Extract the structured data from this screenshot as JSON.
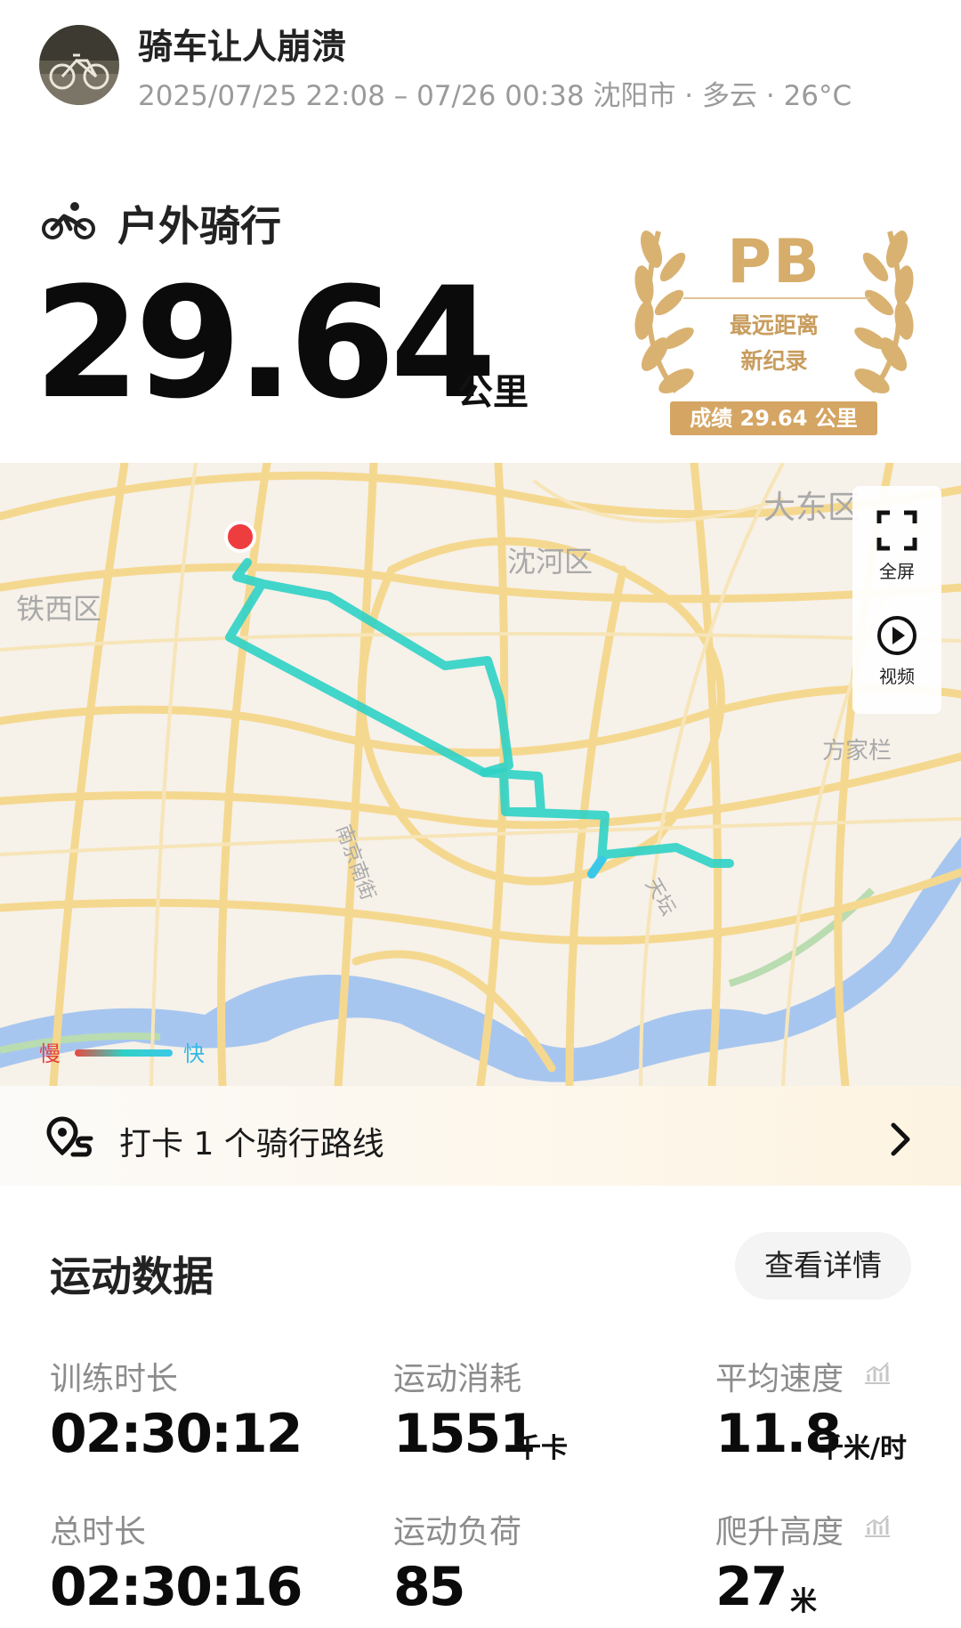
{
  "header": {
    "user_name": "骑车让人崩溃",
    "meta": "2025/07/25 22:08 – 07/26 00:38 沈阳市 · 多云 · 26°C"
  },
  "activity": {
    "type": "户外骑行",
    "distance": "29.64",
    "distance_unit": "公里"
  },
  "badge": {
    "title": "PB",
    "line1": "最远距离",
    "line2": "新纪录",
    "score": "成绩 29.64 公里",
    "color": "#d5a563"
  },
  "map": {
    "labels": {
      "dadong": "大东区",
      "shenhe": "沈河区",
      "tiexi": "铁西区",
      "fangjia": "方家栏",
      "nanjing": "南京南街",
      "tiantan": "天坛"
    },
    "controls": {
      "fullscreen": "全屏",
      "video": "视频"
    },
    "legend": {
      "slow": "慢",
      "fast": "快"
    },
    "route_color": "#2fd1c6",
    "start_color": "#ee3d3f"
  },
  "checkin": {
    "text": "打卡 1 个骑行路线"
  },
  "stats": {
    "title": "运动数据",
    "details_button": "查看详情",
    "items": [
      {
        "label": "训练时长",
        "value": "02:30:12",
        "unit": ""
      },
      {
        "label": "运动消耗",
        "value": "1551",
        "unit": "千卡"
      },
      {
        "label": "平均速度",
        "value": "11.8",
        "unit": "千米/时"
      },
      {
        "label": "总时长",
        "value": "02:30:16",
        "unit": ""
      },
      {
        "label": "运动负荷",
        "value": "85",
        "unit": ""
      },
      {
        "label": "爬升高度",
        "value": "27",
        "unit": "米"
      }
    ]
  }
}
